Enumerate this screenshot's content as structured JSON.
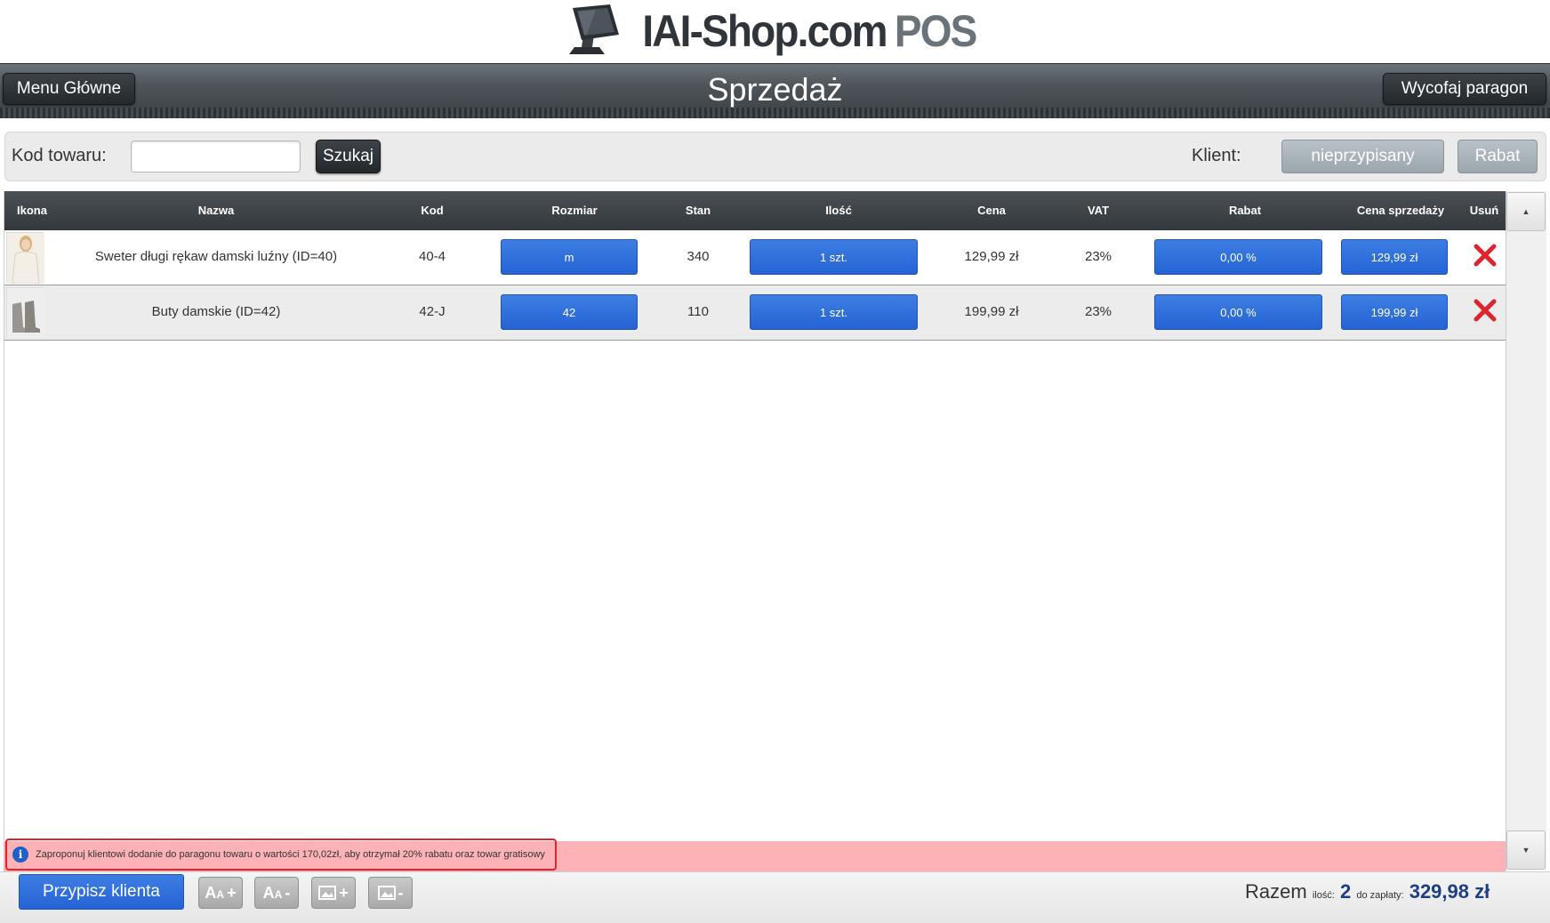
{
  "header": {
    "logo_main": "IAI-Shop.com",
    "logo_suffix": "POS",
    "title": "Sprzedaż",
    "menu_button": "Menu Główne",
    "cancel_button": "Wycofaj paragon"
  },
  "search": {
    "code_label": "Kod towaru:",
    "code_value": "",
    "search_button": "Szukaj",
    "client_label": "Klient:",
    "client_button": "nieprzypisany",
    "discount_button": "Rabat"
  },
  "table": {
    "headers": [
      "Ikona",
      "Nazwa",
      "Kod",
      "Rozmiar",
      "Stan",
      "Ilość",
      "Cena",
      "VAT",
      "Rabat",
      "Cena sprzedaży",
      "Usuń"
    ],
    "rows": [
      {
        "name": "Sweter długi rękaw damski luźny (ID=40)",
        "code": "40-4",
        "size": "m",
        "stock": "340",
        "qty": "1 szt.",
        "price": "129,99 zł",
        "vat": "23%",
        "discount": "0,00 %",
        "sale_price": "129,99 zł",
        "thumb_icon": "sweater-thumbnail"
      },
      {
        "name": "Buty damskie (ID=42)",
        "code": "42-J",
        "size": "42",
        "stock": "110",
        "qty": "1 szt.",
        "price": "199,99 zł",
        "vat": "23%",
        "discount": "0,00 %",
        "sale_price": "199,99 zł",
        "thumb_icon": "boots-thumbnail"
      }
    ]
  },
  "info": {
    "message": "Zaproponuj klientowi dodanie do paragonu towaru o wartości 170,02zł, aby otrzymał 20% rabatu oraz towar gratisowy"
  },
  "footer": {
    "assign_client_button": "Przypisz klienta",
    "font_plus": "+",
    "font_minus": "-",
    "img_plus": "+",
    "img_minus": "-",
    "total_label": "Razem",
    "qty_label": "ilość:",
    "qty_value": "2",
    "pay_label": "do zapłaty:",
    "pay_value": "329,98 zł"
  },
  "colors": {
    "accent_blue": "#2563d4",
    "info_bg": "#fdb2b7",
    "delete_red": "#e0242e",
    "total_blue": "#1e3f86"
  }
}
